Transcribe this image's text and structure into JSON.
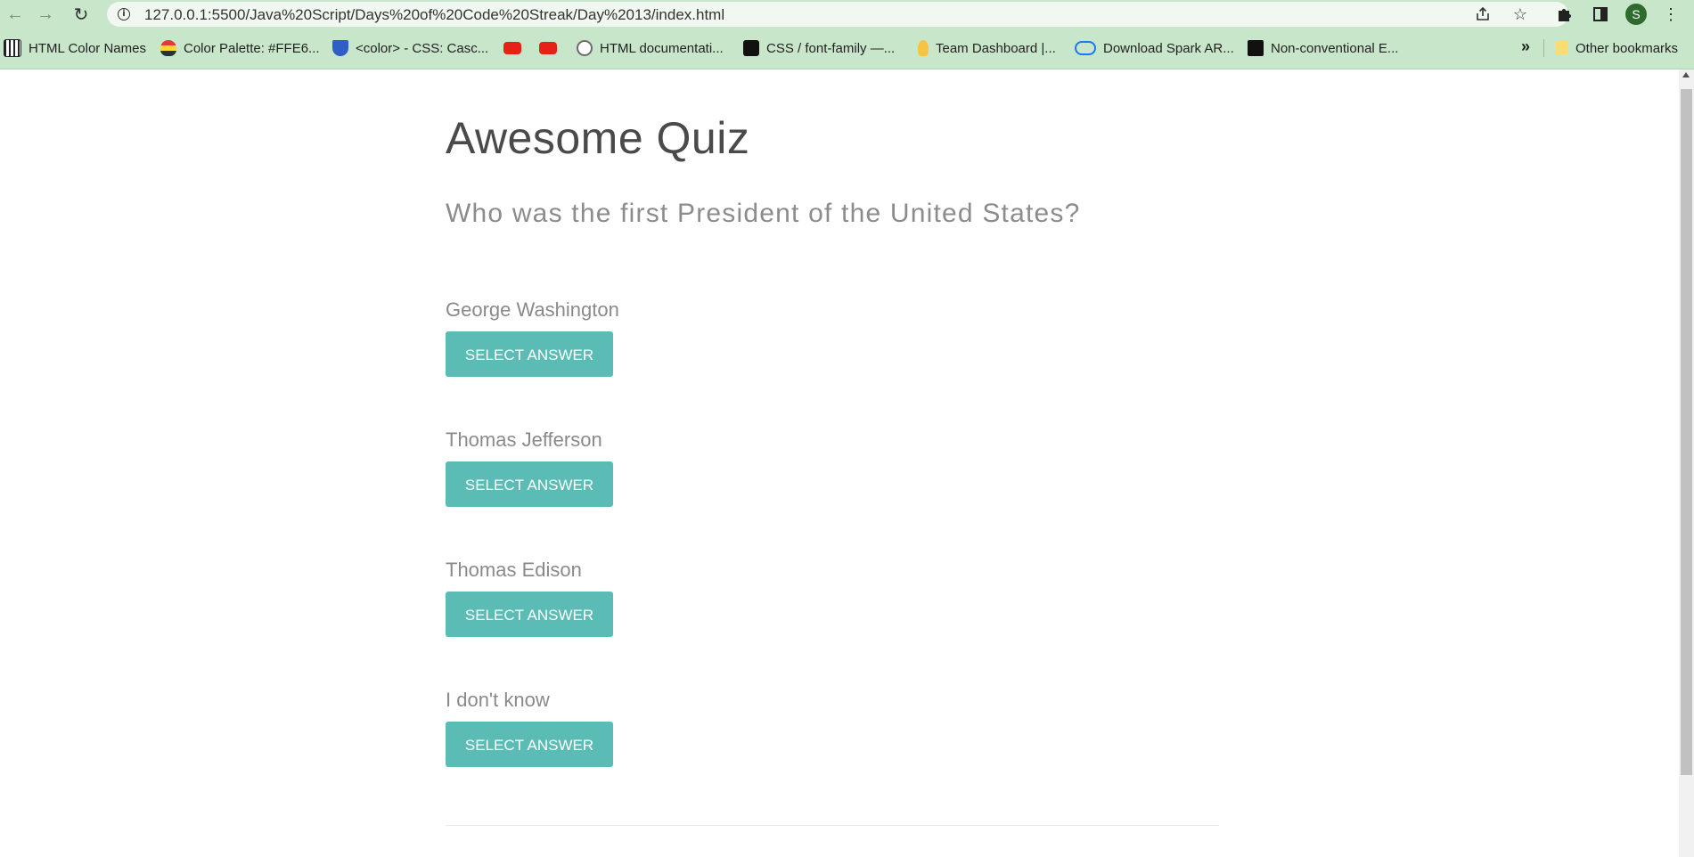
{
  "browser": {
    "url": "127.0.0.1:5500/Java%20Script/Days%20of%20Code%20Streak/Day%2013/index.html",
    "profile_initial": "S",
    "icons": {
      "back": "arrow-left-icon",
      "forward": "arrow-right-icon",
      "reload": "reload-icon",
      "site_info": "info-icon",
      "share": "share-icon",
      "bookmark": "star-icon",
      "extensions": "puzzle-icon",
      "side_panel": "side-panel-icon",
      "menu": "kebab-menu-icon"
    }
  },
  "bookmarks": {
    "items": [
      {
        "label": "HTML Color Names",
        "icon": "piano-icon"
      },
      {
        "label": "Color Palette: #FFE6...",
        "icon": "palette-icon"
      },
      {
        "label": "<color> - CSS: Casc...",
        "icon": "shield-icon"
      },
      {
        "label": "",
        "icon": "youtube-icon"
      },
      {
        "label": "",
        "icon": "youtube-icon"
      },
      {
        "label": "HTML documentati...",
        "icon": "github-icon"
      },
      {
        "label": "CSS / font-family —...",
        "icon": "mascot-icon"
      },
      {
        "label": "Team Dashboard |...",
        "icon": "bulb-icon"
      },
      {
        "label": "Download Spark AR...",
        "icon": "meta-icon"
      },
      {
        "label": "Non-conventional E...",
        "icon": "hashnode-icon"
      }
    ],
    "more": "»",
    "other": "Other bookmarks"
  },
  "quiz": {
    "title": "Awesome Quiz",
    "question": "Who was the first President of the United States?",
    "answers": [
      {
        "text": "George Washington",
        "button": "SELECT ANSWER"
      },
      {
        "text": "Thomas Jefferson",
        "button": "SELECT ANSWER"
      },
      {
        "text": "Thomas Edison",
        "button": "SELECT ANSWER"
      },
      {
        "text": "I don't know",
        "button": "SELECT ANSWER"
      }
    ]
  },
  "colors": {
    "chrome_bar": "#c8e6c9",
    "button": "#5abcb4",
    "title": "#4a4a4a",
    "question": "#8c8c8c"
  }
}
